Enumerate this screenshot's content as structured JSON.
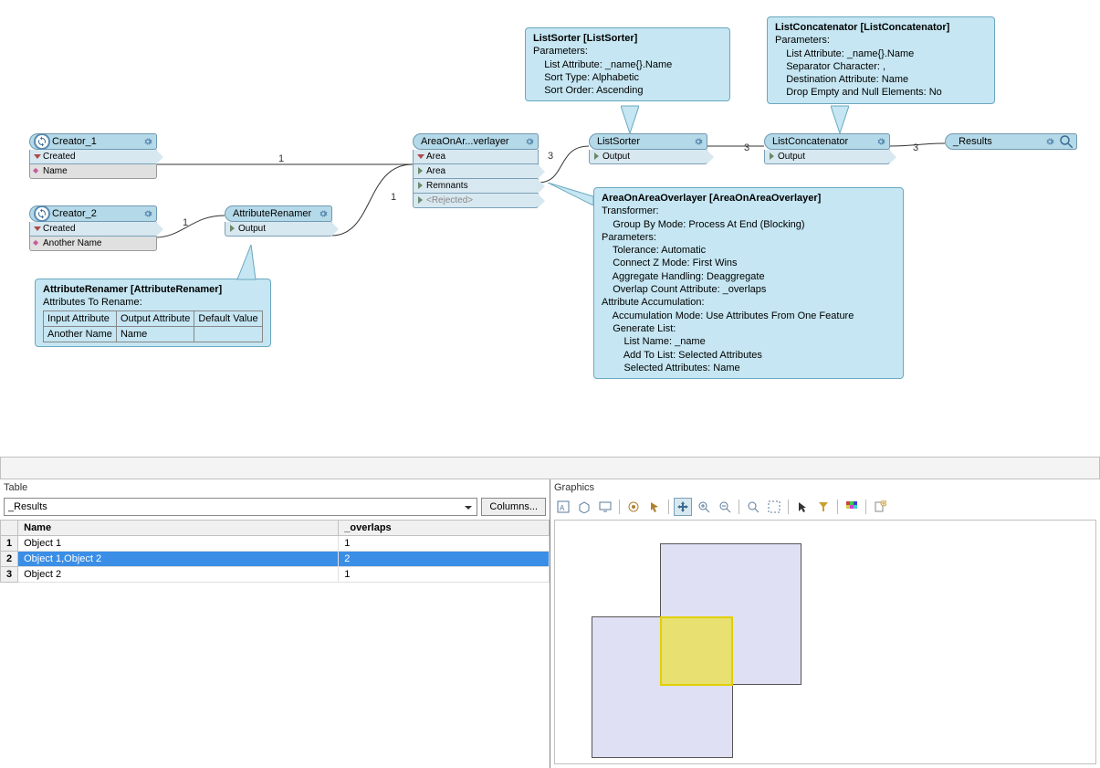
{
  "nodes": {
    "creator1": {
      "title": "Creator_1",
      "port": "Created",
      "attr": "Name"
    },
    "creator2": {
      "title": "Creator_2",
      "port": "Created",
      "attr": "Another Name"
    },
    "attrRenamer": {
      "title": "AttributeRenamer",
      "port": "Output"
    },
    "overlayer": {
      "title": "AreaOnAr...verlayer",
      "in": "Area",
      "p1": "Area",
      "p2": "Remnants",
      "p3": "<Rejected>"
    },
    "listSorter": {
      "title": "ListSorter",
      "port": "Output"
    },
    "listConcat": {
      "title": "ListConcatenator",
      "port": "Output"
    },
    "results": {
      "title": "_Results"
    }
  },
  "linkLabels": {
    "a": "1",
    "b": "1",
    "c": "1",
    "d": "3",
    "e": "3",
    "f": "3"
  },
  "tooltips": {
    "listSorter": {
      "title": "ListSorter [ListSorter]",
      "body": "Parameters:\n    List Attribute: _name{}.Name\n    Sort Type: Alphabetic\n    Sort Order: Ascending"
    },
    "listConcat": {
      "title": "ListConcatenator [ListConcatenator]",
      "body": "Parameters:\n    List Attribute: _name{}.Name\n    Separator Character: ,\n    Destination Attribute: Name\n    Drop Empty and Null Elements: No"
    },
    "attrRenamer": {
      "title": "AttributeRenamer [AttributeRenamer]",
      "sub": "Attributes To Rename:",
      "th1": "Input Attribute",
      "th2": "Output Attribute",
      "th3": "Default Value",
      "r1c1": "Another Name",
      "r1c2": "Name",
      "r1c3": ""
    },
    "overlayer": {
      "title": "AreaOnAreaOverlayer [AreaOnAreaOverlayer]",
      "body": "Transformer:\n    Group By Mode: Process At End (Blocking)\nParameters:\n    Tolerance: Automatic\n    Connect Z Mode: First Wins\n    Aggregate Handling: Deaggregate\n    Overlap Count Attribute: _overlaps\nAttribute Accumulation:\n    Accumulation Mode: Use Attributes From One Feature\n    Generate List:\n        List Name: _name\n        Add To List: Selected Attributes\n        Selected Attributes: Name"
    }
  },
  "panels": {
    "tableLabel": "Table",
    "graphicsLabel": "Graphics",
    "dropdown": "_Results",
    "columnsBtn": "Columns...",
    "columns": {
      "name": "Name",
      "overlaps": "_overlaps"
    },
    "rows": [
      {
        "n": "1",
        "name": "Object 1",
        "overlaps": "1"
      },
      {
        "n": "2",
        "name": "Object 1,Object 2",
        "overlaps": "2"
      },
      {
        "n": "3",
        "name": "Object 2",
        "overlaps": "1"
      }
    ]
  }
}
